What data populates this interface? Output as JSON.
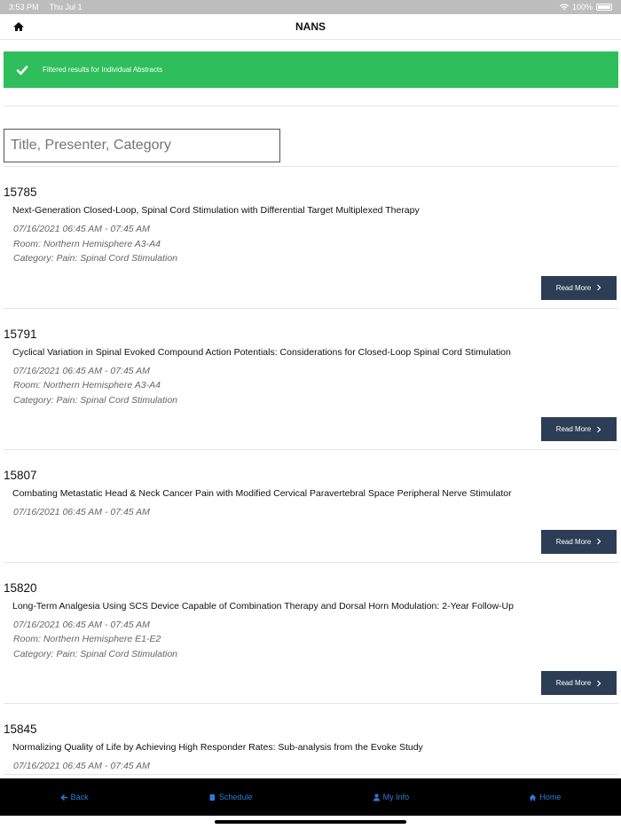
{
  "status": {
    "time": "3:53 PM",
    "date": "Thu Jul 1",
    "battery": "100%"
  },
  "nav": {
    "title": "NANS",
    "home_icon": "home-icon"
  },
  "banner": {
    "message": "Filtered results for Individual Abstracts",
    "color": "#2ebe5b"
  },
  "search": {
    "placeholder": "Title, Presenter, Category"
  },
  "abstracts": [
    {
      "id": "15785",
      "title": "Next-Generation Closed-Loop, Spinal Cord Stimulation with Differential Target Multiplexed Therapy",
      "time": "07/16/2021 06:45 AM - 07:45 AM",
      "room": "Room: Northern Hemisphere A3-A4",
      "category": "Category: Pain: Spinal Cord Stimulation",
      "button": "Read More"
    },
    {
      "id": "15791",
      "title": "Cyclical Variation in Spinal Evoked Compound Action Potentials: Considerations for Closed-Loop Spinal Cord Stimulation",
      "time": "07/16/2021 06:45 AM - 07:45 AM",
      "room": "Room: Northern Hemisphere A3-A4",
      "category": "Category: Pain: Spinal Cord Stimulation",
      "button": "Read More"
    },
    {
      "id": "15807",
      "title": "Combating Metastatic Head & Neck Cancer Pain with Modified Cervical Paravertebral Space Peripheral Nerve Stimulator",
      "time": "07/16/2021 06:45 AM - 07:45 AM",
      "button": "Read More"
    },
    {
      "id": "15820",
      "title": "Long-Term Analgesia Using SCS Device Capable of Combination Therapy and Dorsal Horn Modulation: 2-Year Follow-Up",
      "time": "07/16/2021 06:45 AM - 07:45 AM",
      "room": "Room: Northern Hemisphere E1-E2",
      "category": "Category: Pain: Spinal Cord Stimulation",
      "button": "Read More"
    },
    {
      "id": "15845",
      "title": "Normalizing Quality of Life by Achieving High Responder Rates: Sub-analysis from the Evoke Study",
      "time": "07/16/2021 06:45 AM - 07:45 AM"
    }
  ],
  "tabs": {
    "back": "Back",
    "schedule": "Schedule",
    "myinfo": "My Info",
    "home": "Home"
  },
  "colors": {
    "tab_link": "#2f7bd6",
    "button_bg": "#2c3e55",
    "tabbar_bg": "#000000"
  }
}
